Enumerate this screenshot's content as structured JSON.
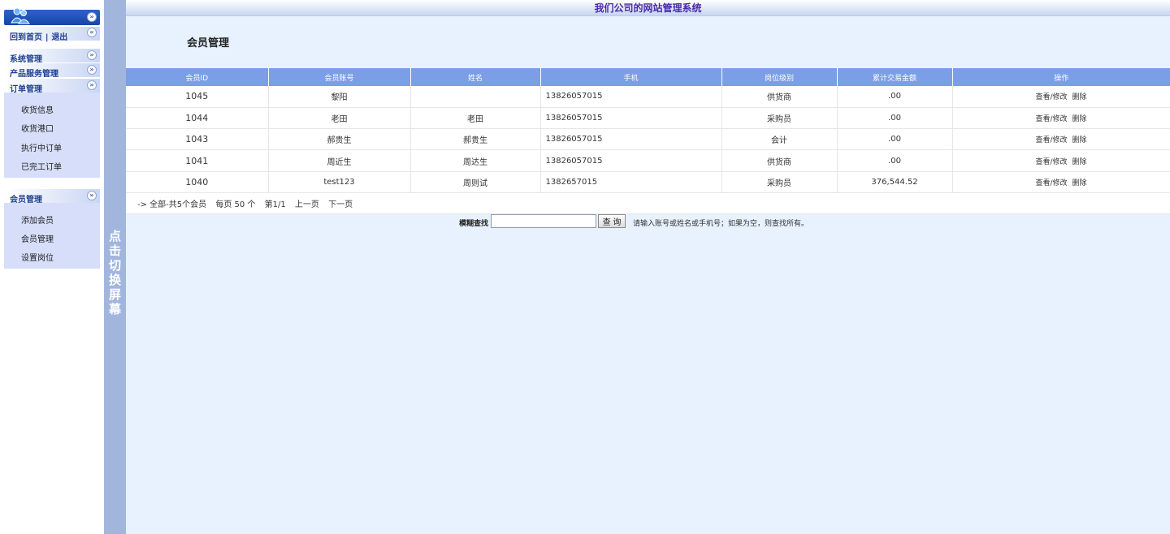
{
  "header": {
    "system_title": "我们公司的网站管理系统"
  },
  "sidebar": {
    "home_link": "回到首页",
    "separator": "|",
    "logout_link": "退出",
    "collapse_glyph": "«",
    "expand_glyph": "»",
    "sections": [
      {
        "label": "系统管理"
      },
      {
        "label": "产品服务管理"
      },
      {
        "label": "订单管理",
        "items": [
          "收货信息",
          "收货港口",
          "执行中订单",
          "已完工订单"
        ]
      },
      {
        "label": "会员管理",
        "items": [
          "添加会员",
          "会员管理",
          "设置岗位"
        ]
      }
    ]
  },
  "switch_bar": {
    "chars": [
      "点",
      "击",
      "切",
      "换",
      "屏",
      "幕"
    ]
  },
  "main": {
    "title": "会员管理",
    "table": {
      "columns": [
        "会员ID",
        "会员账号",
        "姓名",
        "手机",
        "岗位级别",
        "累计交易金额",
        "操作"
      ],
      "rows": [
        {
          "id": "1045",
          "account": "黎阳",
          "name": "",
          "phone": "13826057015",
          "role": "供货商",
          "amount": ".00"
        },
        {
          "id": "1044",
          "account": "老田",
          "name": "老田",
          "phone": "13826057015",
          "role": "采购员",
          "amount": ".00"
        },
        {
          "id": "1043",
          "account": "郝贵生",
          "name": "郝贵生",
          "phone": "13826057015",
          "role": "会计",
          "amount": ".00"
        },
        {
          "id": "1041",
          "account": "周近生",
          "name": "周达生",
          "phone": "13826057015",
          "role": "供货商",
          "amount": ".00"
        },
        {
          "id": "1040",
          "account": "test123",
          "name": "周则试",
          "phone": "1382657015",
          "role": "采购员",
          "amount": "376,544.52"
        }
      ],
      "actions": {
        "view_edit": "查看/修改",
        "delete": "删除"
      }
    },
    "pager": {
      "summary": "-> 全部-共5个会员",
      "per_page": "每页 50 个",
      "page": "第1/1",
      "prev": "上一页",
      "next": "下一页"
    },
    "search": {
      "label": "模糊查找",
      "value": "",
      "button": "查 询",
      "hint": "请输入账号或姓名或手机号；如果为空，则查找所有。"
    }
  }
}
